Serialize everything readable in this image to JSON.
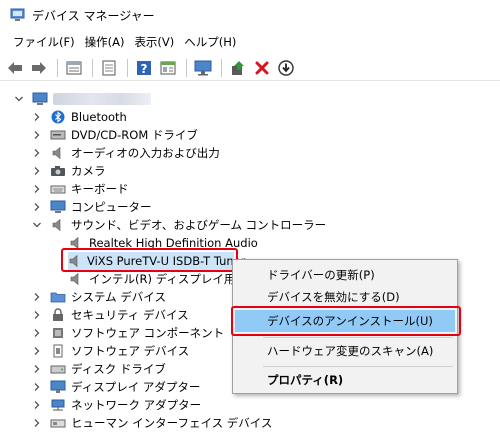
{
  "window": {
    "title": "デバイス マネージャー"
  },
  "menu": [
    "ファイル(F)",
    "操作(A)",
    "表示(V)",
    "ヘルプ(H)"
  ],
  "toolbar": {
    "icons": [
      "back-icon",
      "forward-icon",
      "properties-icon",
      "document-icon",
      "help-icon",
      "details-icon",
      "monitor-icon",
      "update-driver-icon",
      "uninstall-x-icon",
      "download-icon"
    ]
  },
  "tree": {
    "items": [
      {
        "label": "Bluetooth",
        "icon": "bluetooth-icon"
      },
      {
        "label": "DVD/CD-ROM ドライブ",
        "icon": "disc-drive-icon"
      },
      {
        "label": "オーディオの入力および出力",
        "icon": "speaker-icon"
      },
      {
        "label": "カメラ",
        "icon": "camera-icon"
      },
      {
        "label": "キーボード",
        "icon": "keyboard-icon"
      },
      {
        "label": "コンピューター",
        "icon": "computer-icon"
      },
      {
        "label": "サウンド、ビデオ、およびゲーム コントローラー",
        "icon": "speaker-icon"
      },
      {
        "label": "Realtek High Definition Audio",
        "icon": "speaker-icon"
      },
      {
        "label": "ViXS PureTV-U ISDB-T Tuner",
        "icon": "speaker-icon"
      },
      {
        "label": "インテル(R) ディスプレイ用オーディオ",
        "icon": "speaker-icon"
      },
      {
        "label": "システム デバイス",
        "icon": "folder-icon"
      },
      {
        "label": "セキュリティ デバイス",
        "icon": "security-icon"
      },
      {
        "label": "ソフトウェア コンポーネント",
        "icon": "component-icon"
      },
      {
        "label": "ソフトウェア デバイス",
        "icon": "software-device-icon"
      },
      {
        "label": "ディスク ドライブ",
        "icon": "disk-icon"
      },
      {
        "label": "ディスプレイ アダプター",
        "icon": "display-icon"
      },
      {
        "label": "ネットワーク アダプター",
        "icon": "network-icon"
      },
      {
        "label": "ヒューマン インターフェイス デバイス",
        "icon": "hid-icon"
      }
    ]
  },
  "context_menu": {
    "items": [
      {
        "label": "ドライバーの更新(P)"
      },
      {
        "label": "デバイスを無効にする(D)"
      },
      {
        "label": "デバイスのアンインストール(U)"
      },
      {
        "label": "ハードウェア変更のスキャン(A)"
      },
      {
        "label": "プロパティ(R)"
      }
    ]
  },
  "colors": {
    "highlight": "#91c9f7",
    "selection": "#cce4f7",
    "callout": "#e60012"
  }
}
